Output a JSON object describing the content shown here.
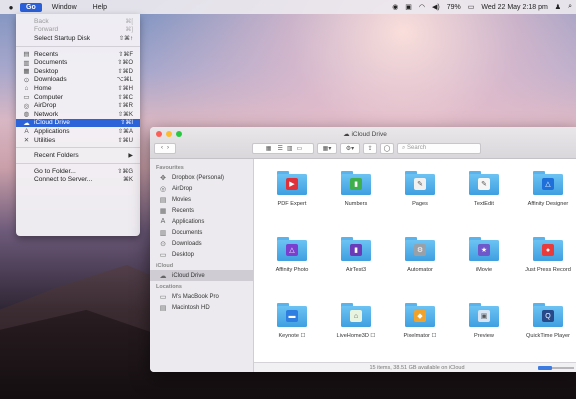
{
  "menubar": {
    "apple_icon": "apple-logo-icon",
    "menus": [
      "Go",
      "Window",
      "Help"
    ],
    "status_clock": "Wed 22 May 2:18 pm",
    "status_icons": [
      "1password-icon",
      "screen-icon",
      "wifi-icon",
      "volume-icon",
      "battery-icon"
    ],
    "battery": "79%",
    "accent": "#2a5fd8"
  },
  "go_menu": {
    "items": [
      {
        "label": "Back",
        "shortcut": "⌘[",
        "disabled": true,
        "icon": ""
      },
      {
        "label": "Forward",
        "shortcut": "⌘]",
        "disabled": true,
        "icon": ""
      },
      {
        "label": "Select Startup Disk",
        "shortcut": "⇧⌘↑",
        "disabled": false,
        "icon": ""
      },
      {
        "sep": true
      },
      {
        "label": "Recents",
        "shortcut": "⇧⌘F",
        "icon": "▤"
      },
      {
        "label": "Documents",
        "shortcut": "⇧⌘O",
        "icon": "▥"
      },
      {
        "label": "Desktop",
        "shortcut": "⇧⌘D",
        "icon": "▦"
      },
      {
        "label": "Downloads",
        "shortcut": "⌥⌘L",
        "icon": "⊙"
      },
      {
        "label": "Home",
        "shortcut": "⇧⌘H",
        "icon": "⌂"
      },
      {
        "label": "Computer",
        "shortcut": "⇧⌘C",
        "icon": "▭"
      },
      {
        "label": "AirDrop",
        "shortcut": "⇧⌘R",
        "icon": "◎"
      },
      {
        "label": "Network",
        "shortcut": "⇧⌘K",
        "icon": "◍"
      },
      {
        "label": "iCloud Drive",
        "shortcut": "⇧⌘I",
        "icon": "☁",
        "selected": true
      },
      {
        "label": "Applications",
        "shortcut": "⇧⌘A",
        "icon": "A"
      },
      {
        "label": "Utilities",
        "shortcut": "⇧⌘U",
        "icon": "✕"
      },
      {
        "sep": true
      },
      {
        "label": "Recent Folders",
        "shortcut": "▶",
        "icon": ""
      },
      {
        "sep": true
      },
      {
        "label": "Go to Folder...",
        "shortcut": "⇧⌘G",
        "icon": ""
      },
      {
        "label": "Connect to Server...",
        "shortcut": "⌘K",
        "icon": ""
      }
    ]
  },
  "finder": {
    "title": "iCloud Drive",
    "search_placeholder": "Search",
    "sidebar": {
      "favourites_heading": "Favourites",
      "favourites": [
        {
          "label": "Dropbox (Personal)",
          "icon": "dropbox-icon",
          "glyph": "✥"
        },
        {
          "label": "AirDrop",
          "icon": "airdrop-icon",
          "glyph": "◎"
        },
        {
          "label": "Movies",
          "icon": "movies-icon",
          "glyph": "▤"
        },
        {
          "label": "Recents",
          "icon": "recents-icon",
          "glyph": "▦"
        },
        {
          "label": "Applications",
          "icon": "applications-icon",
          "glyph": "A"
        },
        {
          "label": "Documents",
          "icon": "documents-icon",
          "glyph": "▥"
        },
        {
          "label": "Downloads",
          "icon": "downloads-icon",
          "glyph": "⊙"
        },
        {
          "label": "Desktop",
          "icon": "desktop-icon",
          "glyph": "▭"
        }
      ],
      "icloud_heading": "iCloud",
      "icloud": [
        {
          "label": "iCloud Drive",
          "icon": "cloud-icon",
          "glyph": "☁",
          "selected": true
        }
      ],
      "locations_heading": "Locations",
      "locations": [
        {
          "label": "M's MacBook Pro",
          "icon": "laptop-icon",
          "glyph": "▭"
        },
        {
          "label": "Macintosh HD",
          "icon": "disk-icon",
          "glyph": "▤"
        }
      ]
    },
    "items": [
      {
        "label": "PDF Expert",
        "badge_color": "#e0313a",
        "glyph": "▶"
      },
      {
        "label": "Numbers",
        "badge_color": "#3fae4d",
        "glyph": "▮"
      },
      {
        "label": "Pages",
        "badge_color": "#f0f0f0",
        "glyph": "✎"
      },
      {
        "label": "TextEdit",
        "badge_color": "#f6f6f6",
        "glyph": "✎"
      },
      {
        "label": "Affinity Designer",
        "badge_color": "#1e6fd9",
        "glyph": "△"
      },
      {
        "label": "Affinity Photo",
        "badge_color": "#7b3fcf",
        "glyph": "△"
      },
      {
        "label": "AirTest3",
        "badge_color": "#6a3ab8",
        "glyph": "▮"
      },
      {
        "label": "Automator",
        "badge_color": "#9aa0a8",
        "glyph": "⚙"
      },
      {
        "label": "iMovie",
        "badge_color": "#6f58c9",
        "glyph": "★"
      },
      {
        "label": "Just Press Record",
        "badge_color": "#e93b3b",
        "glyph": "●"
      },
      {
        "label": "Keynote ☐",
        "badge_color": "#2e7de0",
        "glyph": "▬"
      },
      {
        "label": "LiveHome3D ☐",
        "badge_color": "#e8f3e0",
        "glyph": "⌂"
      },
      {
        "label": "Pixelmator ☐",
        "badge_color": "#f0a22a",
        "glyph": "◆"
      },
      {
        "label": "Preview",
        "badge_color": "#d6e4f5",
        "glyph": "▣"
      },
      {
        "label": "QuickTime Player",
        "badge_color": "#274a8a",
        "glyph": "Q"
      }
    ],
    "status_text": "15 items, 38.51 GB available on iCloud",
    "icon_size_fraction": 0.4
  }
}
